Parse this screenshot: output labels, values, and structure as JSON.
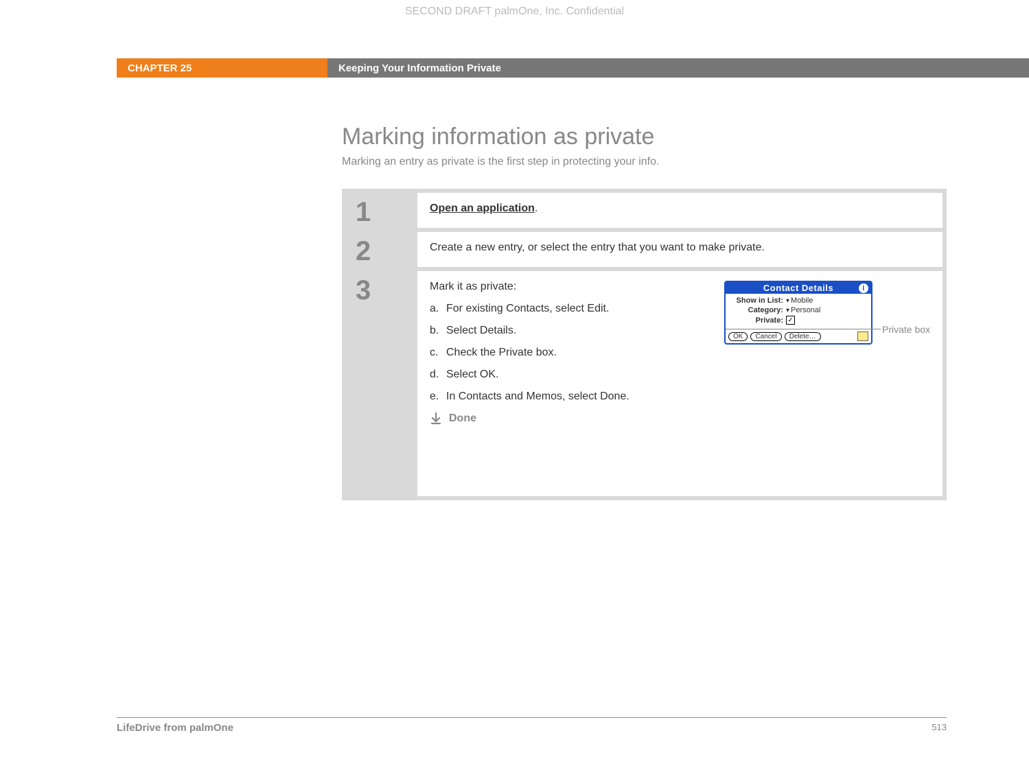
{
  "draft_header": "SECOND DRAFT palmOne, Inc.  Confidential",
  "chapter_label": "CHAPTER 25",
  "chapter_title": "Keeping Your Information Private",
  "h1": "Marking information as private",
  "subtitle": "Marking an entry as private is the first step in protecting your info.",
  "steps": {
    "s1": {
      "num": "1",
      "link": "Open an application",
      "after": "."
    },
    "s2": {
      "num": "2",
      "text": "Create a new entry, or select the entry that you want to make private."
    },
    "s3": {
      "num": "3",
      "intro": "Mark it as private:",
      "a_lab": "a.",
      "a_txt": "For existing Contacts, select Edit.",
      "b_lab": "b.",
      "b_txt": "Select Details.",
      "c_lab": "c.",
      "c_txt": "Check the Private box.",
      "d_lab": "d.",
      "d_txt": "Select OK.",
      "e_lab": "e.",
      "e_txt": "In Contacts and Memos, select Done.",
      "done": "Done"
    }
  },
  "callout": {
    "label": "Private box",
    "dialog_title": "Contact Details",
    "row1_label": "Show in List:",
    "row1_value": "Mobile",
    "row2_label": "Category:",
    "row2_value": "Personal",
    "row3_label": "Private:",
    "checkmark": "✓",
    "btn_ok": "OK",
    "btn_cancel": "Cancel",
    "btn_delete": "Delete…"
  },
  "footer": {
    "left": "LifeDrive from palmOne",
    "page": "513"
  }
}
